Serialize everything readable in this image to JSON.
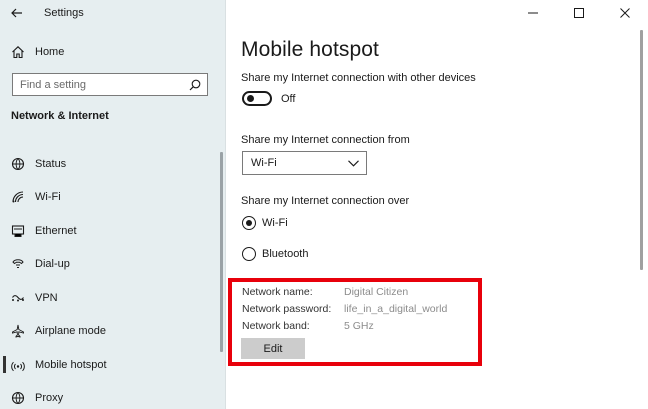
{
  "window": {
    "title": "Settings"
  },
  "sidebar": {
    "home_label": "Home",
    "search_placeholder": "Find a setting",
    "section_title": "Network & Internet",
    "items": [
      {
        "label": "Status",
        "icon": "globe-status-icon"
      },
      {
        "label": "Wi-Fi",
        "icon": "wifi-icon"
      },
      {
        "label": "Ethernet",
        "icon": "ethernet-icon"
      },
      {
        "label": "Dial-up",
        "icon": "dialup-icon"
      },
      {
        "label": "VPN",
        "icon": "vpn-icon"
      },
      {
        "label": "Airplane mode",
        "icon": "airplane-icon"
      },
      {
        "label": "Mobile hotspot",
        "icon": "hotspot-icon",
        "selected": true
      },
      {
        "label": "Proxy",
        "icon": "globe-icon"
      }
    ]
  },
  "main": {
    "title": "Mobile hotspot",
    "share_label": "Share my Internet connection with other devices",
    "toggle_state": "Off",
    "share_from_label": "Share my Internet connection from",
    "share_from_value": "Wi-Fi",
    "share_over_label": "Share my Internet connection over",
    "share_over_options": [
      {
        "label": "Wi-Fi",
        "selected": true
      },
      {
        "label": "Bluetooth",
        "selected": false
      }
    ],
    "network": {
      "name_label": "Network name:",
      "name_value": "Digital Citizen",
      "password_label": "Network password:",
      "password_value": "life_in_a_digital_world",
      "band_label": "Network band:",
      "band_value": "5 GHz",
      "edit_label": "Edit"
    }
  },
  "colors": {
    "sidebar_bg": "#e6eef0",
    "highlight_border": "#e8000b",
    "button_bg": "#cccccc"
  }
}
